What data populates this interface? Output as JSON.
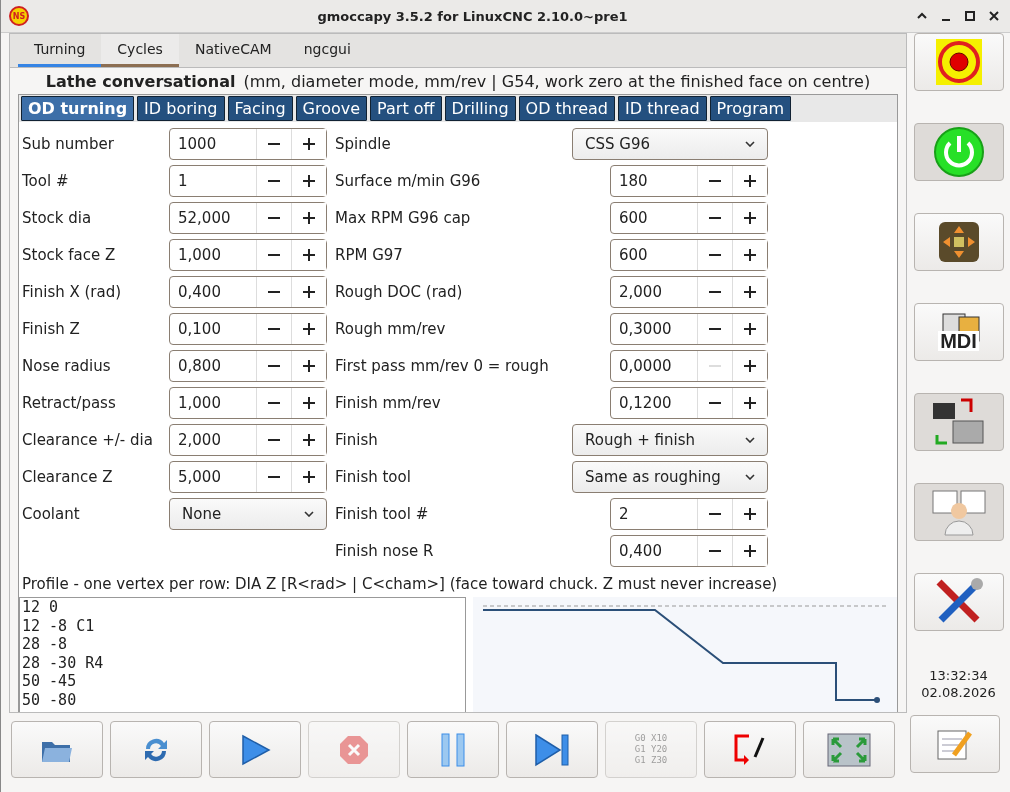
{
  "window": {
    "logo": "NS",
    "title": "gmoccapy 3.5.2 for LinuxCNC 2.10.0~pre1"
  },
  "tabs": [
    {
      "label": "Turning",
      "selected": true,
      "hover": false
    },
    {
      "label": "Cycles",
      "selected": false,
      "hover": true
    },
    {
      "label": "NativeCAM",
      "selected": false,
      "hover": false
    },
    {
      "label": "ngcgui",
      "selected": false,
      "hover": false
    }
  ],
  "heading": {
    "title": "Lathe conversational",
    "subtitle": "(mm, diameter mode, mm/rev  |  G54, work zero at the finished face on centre)"
  },
  "cycle_tabs": [
    {
      "label": "OD turning",
      "selected": true
    },
    {
      "label": "ID boring",
      "selected": false
    },
    {
      "label": "Facing",
      "selected": false
    },
    {
      "label": "Groove",
      "selected": false
    },
    {
      "label": "Part off",
      "selected": false
    },
    {
      "label": "Drilling",
      "selected": false
    },
    {
      "label": "OD thread",
      "selected": false
    },
    {
      "label": "ID thread",
      "selected": false
    },
    {
      "label": "Program",
      "selected": false
    }
  ],
  "left_fields": [
    {
      "label": "Sub number",
      "kind": "spin",
      "value": "1000",
      "minus_disabled": false
    },
    {
      "label": "Tool #",
      "kind": "spin",
      "value": "1",
      "minus_disabled": false
    },
    {
      "label": "Stock dia",
      "kind": "spin",
      "value": "52,000",
      "minus_disabled": false
    },
    {
      "label": "Stock face Z",
      "kind": "spin",
      "value": "1,000",
      "minus_disabled": false
    },
    {
      "label": "Finish X (rad)",
      "kind": "spin",
      "value": "0,400",
      "minus_disabled": false
    },
    {
      "label": "Finish Z",
      "kind": "spin",
      "value": "0,100",
      "minus_disabled": false
    },
    {
      "label": "Nose radius",
      "kind": "spin",
      "value": "0,800",
      "minus_disabled": false
    },
    {
      "label": "Retract/pass",
      "kind": "spin",
      "value": "1,000",
      "minus_disabled": false
    },
    {
      "label": "Clearance +/- dia",
      "kind": "spin",
      "value": "2,000",
      "minus_disabled": false
    },
    {
      "label": "Clearance Z",
      "kind": "spin",
      "value": "5,000",
      "minus_disabled": false
    },
    {
      "label": "Coolant",
      "kind": "combo",
      "value": "None"
    }
  ],
  "right_fields": [
    {
      "label": "Spindle",
      "kind": "combo",
      "value": "CSS  G96"
    },
    {
      "label": "Surface m/min  G96",
      "kind": "spin",
      "value": "180",
      "minus_disabled": false
    },
    {
      "label": "Max RPM  G96 cap",
      "kind": "spin",
      "value": "600",
      "minus_disabled": false
    },
    {
      "label": "RPM  G97",
      "kind": "spin",
      "value": "600",
      "minus_disabled": false
    },
    {
      "label": "Rough DOC (rad)",
      "kind": "spin",
      "value": "2,000",
      "minus_disabled": false
    },
    {
      "label": "Rough mm/rev",
      "kind": "spin",
      "value": "0,3000",
      "minus_disabled": false
    },
    {
      "label": "First pass mm/rev  0 = rough",
      "kind": "spin",
      "value": "0,0000",
      "minus_disabled": true
    },
    {
      "label": "Finish mm/rev",
      "kind": "spin",
      "value": "0,1200",
      "minus_disabled": false
    },
    {
      "label": "Finish",
      "kind": "combo",
      "value": "Rough + finish"
    },
    {
      "label": "Finish tool",
      "kind": "combo",
      "value": "Same as roughing"
    },
    {
      "label": "Finish tool #",
      "kind": "spin",
      "value": "2",
      "minus_disabled": false
    },
    {
      "label": "Finish nose R",
      "kind": "spin",
      "value": "0,400",
      "minus_disabled": false
    }
  ],
  "profile": {
    "label": "Profile  -  one vertex per row:  DIA  Z  [R<rad> | C<cham>]   (face toward chuck.  Z must never increase)",
    "lines": [
      "12 0",
      "12 -8 C1",
      "28 -8",
      "28 -30 R4",
      "50 -45",
      "50 -80"
    ]
  },
  "sidebar": [
    {
      "kind": "estop",
      "active": false
    },
    {
      "kind": "power",
      "active": true
    },
    {
      "kind": "jog",
      "active": false
    },
    {
      "kind": "mdi",
      "label": "MDI",
      "active": false
    },
    {
      "kind": "auto",
      "active": true
    },
    {
      "kind": "user",
      "active": true
    },
    {
      "kind": "tools",
      "active": false
    }
  ],
  "clock": {
    "time": "13:32:34",
    "date": "02.08.2026"
  },
  "toolbar": [
    {
      "kind": "open",
      "disabled": false
    },
    {
      "kind": "reload",
      "disabled": false
    },
    {
      "kind": "run",
      "disabled": false
    },
    {
      "kind": "stop",
      "disabled": true
    },
    {
      "kind": "pause",
      "disabled": false
    },
    {
      "kind": "step",
      "disabled": false
    },
    {
      "kind": "gcode",
      "lines": [
        "G0 X10",
        "G1 Y20",
        "G1 Z30"
      ],
      "disabled": true
    },
    {
      "kind": "exit",
      "disabled": false
    },
    {
      "kind": "fullscreen",
      "disabled": false
    }
  ],
  "edit_button": {
    "kind": "notes"
  }
}
